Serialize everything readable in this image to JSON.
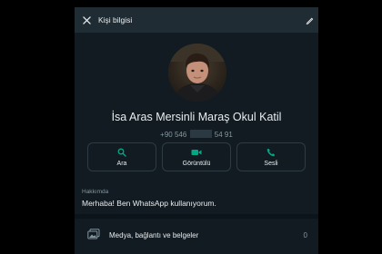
{
  "header": {
    "title": "Kişi bilgisi",
    "close_icon": "close-icon",
    "edit_icon": "pencil-icon"
  },
  "profile": {
    "avatar": "contact-profile-photo",
    "name": "İsa Aras Mersinli Maraş Okul Katil",
    "phone_prefix": "+90 546",
    "phone_suffix": "54 91"
  },
  "actions": [
    {
      "label": "Ara",
      "icon": "search-icon"
    },
    {
      "label": "Görüntülü",
      "icon": "video-camera-icon"
    },
    {
      "label": "Sesli",
      "icon": "phone-icon"
    }
  ],
  "about": {
    "label": "Hakkımda",
    "text": "Merhaba! Ben WhatsApp kullanıyorum."
  },
  "media": {
    "label": "Medya, bağlantı ve belgeler",
    "count": "0",
    "icon": "media-gallery-icon"
  },
  "colors": {
    "background": "#000000",
    "panel": "#111b21",
    "header": "#1f2c33",
    "accent": "#00a884",
    "text_primary": "#e9edef",
    "text_secondary": "#8696a0"
  }
}
